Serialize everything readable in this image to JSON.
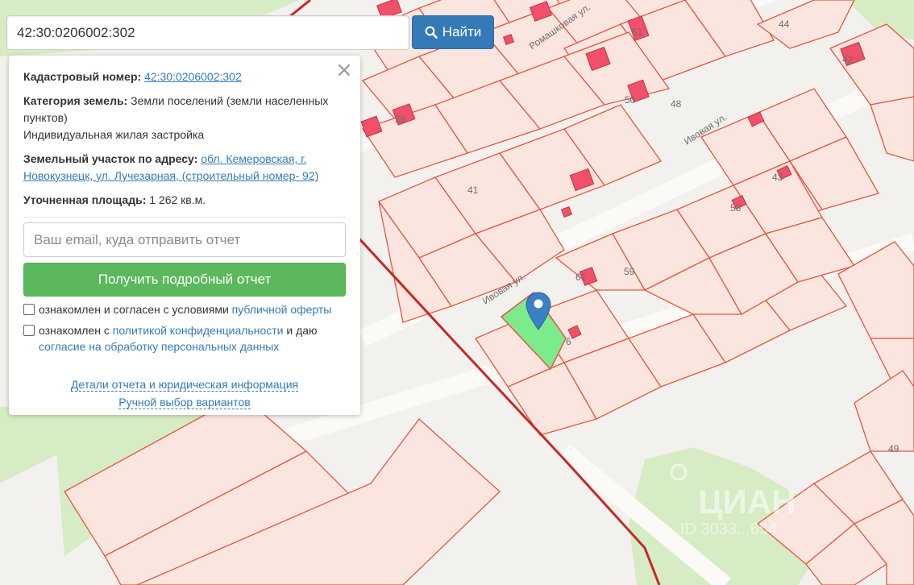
{
  "search": {
    "value": "42:30:0206002:302",
    "button_label": "Найти",
    "button_color": "#337ab7"
  },
  "info": {
    "cadastral_label": "Кадастровый номер:",
    "cadastral_number": "42:30:0206002:302",
    "category_label": "Категория земель:",
    "category_value": "Земли поселений (земли населенных пунктов)",
    "usage_value": "Индивидуальная жилая застройка",
    "address_label": "Земельный участок по адресу:",
    "address_value": "обл. Кемеровская, г. Новокузнецк, ул. Лучезарная, (строительный номер- 92)",
    "area_label": "Уточненная площадь:",
    "area_value": "1 262 кв.м."
  },
  "report": {
    "email_placeholder": "Ваш email, куда отправить отчет",
    "button_label": "Получить подробный отчет",
    "button_color": "#5cb85c"
  },
  "consents": {
    "offer_text": "ознакомлен и согласен с условиями ",
    "offer_link": "публичной оферты",
    "privacy_text": "ознакомлен с ",
    "privacy_link": "политикой конфиденциальности",
    "privacy_and": " и даю",
    "personal_data_link": "согласие на обработку персональных данных"
  },
  "links": {
    "details": "Детали отчета и юридическая информация",
    "manual": "Ручной выбор вариантов"
  },
  "map": {
    "streets": [
      "Ромашковая ул.",
      "Ивовая ул.",
      "Ивовая ул."
    ],
    "lot_numbers": [
      "44",
      "42",
      "51",
      "50",
      "48",
      "28",
      "43",
      "41",
      "53",
      "59",
      "61",
      "6",
      "49"
    ],
    "watermark": "ЦИАН",
    "watermark_id": "ID 3033...654",
    "colors": {
      "parcel_border": "#e8553f",
      "parcel_fill": "#fbe6df",
      "building": "#f0506a",
      "selected": "#7ceb8c",
      "green_area": "#d6ecc4",
      "red_line": "#c62828"
    }
  },
  "close_symbol": "×"
}
